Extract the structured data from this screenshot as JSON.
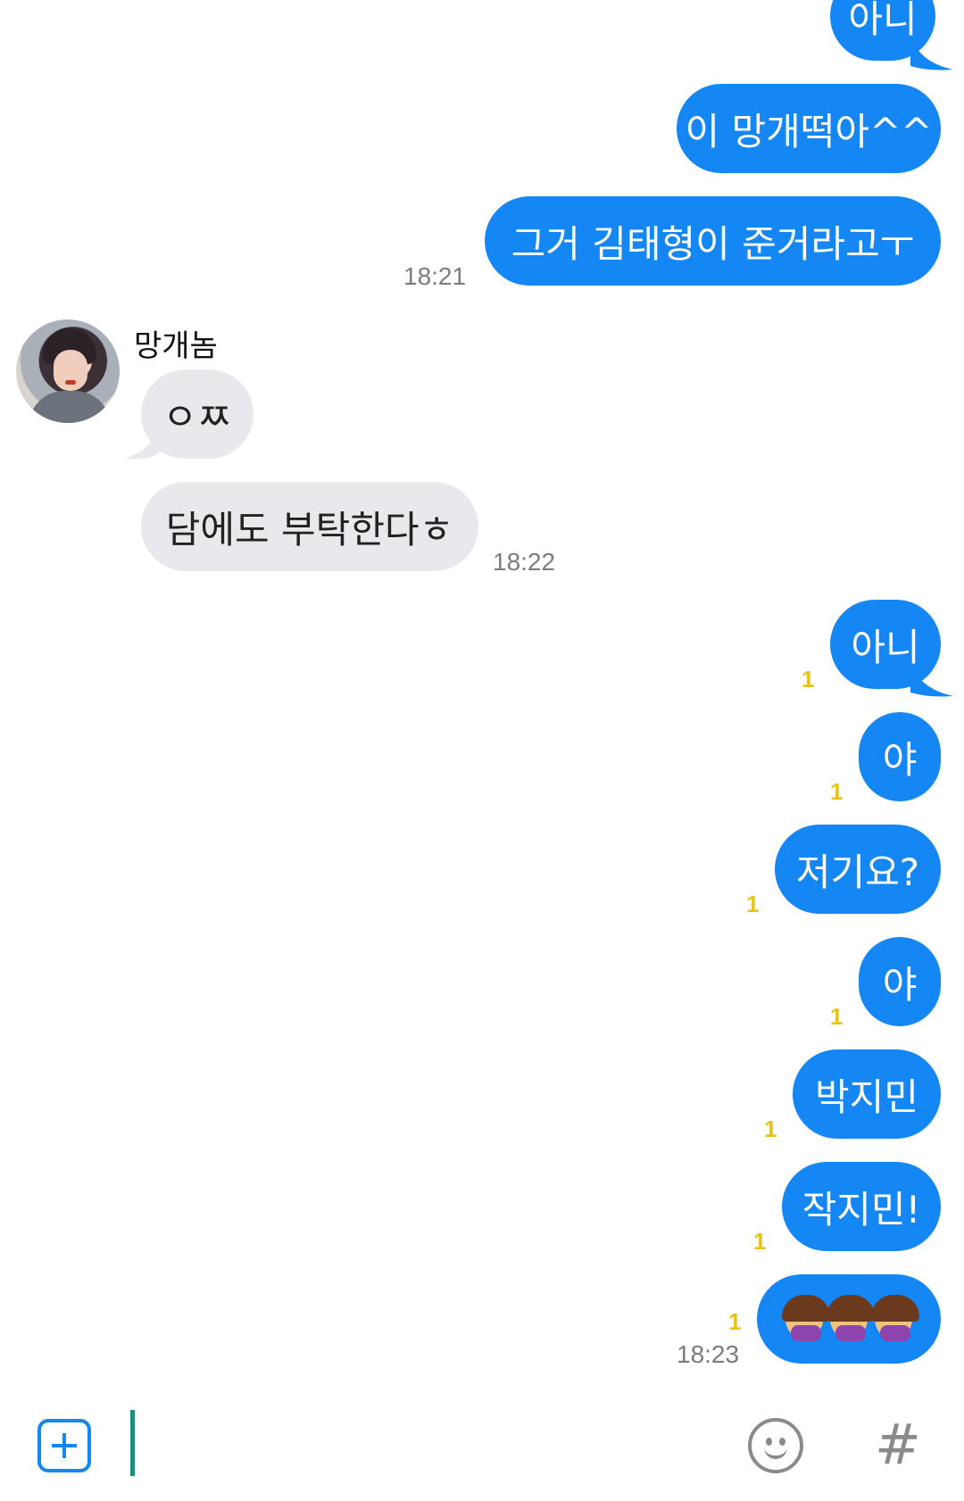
{
  "messages": {
    "m1": "아니",
    "m2": "이 망개떡아^^",
    "m3": "그거 김태형이 준거라고ㅜ",
    "m4": "ㅇㅉ",
    "m5": "담에도 부탁한다ㅎ",
    "m6": "아니",
    "m7": "야",
    "m8": "저기요?",
    "m9": "야",
    "m10": "박지민",
    "m11": "작지민!"
  },
  "times": {
    "t1": "18:21",
    "t2": "18:22",
    "t3": "18:23"
  },
  "unread": "1",
  "sender_name": "망개놈",
  "emoji_message": "person-facepalming x3",
  "colors": {
    "my_bubble": "#1487f5",
    "their_bubble": "#e9e9ed",
    "unread": "#e6c21a",
    "cursor": "#1a8f7a"
  },
  "icons": [
    "plus-icon",
    "emoji-icon",
    "hashtag-icon"
  ],
  "hash_glyph": "#"
}
